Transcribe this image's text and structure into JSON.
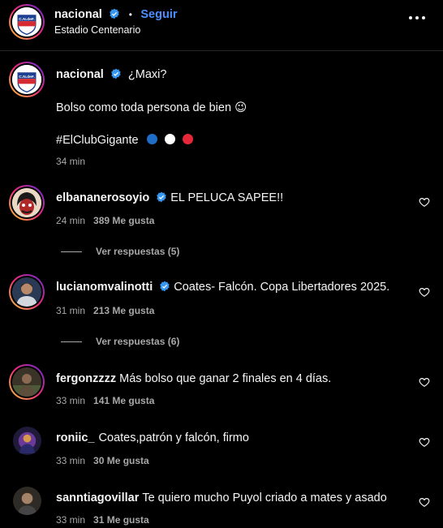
{
  "header": {
    "username": "nacional",
    "follow_label": "Seguir",
    "location": "Estadio Centenario",
    "crest_text": "C.N.deF."
  },
  "caption": {
    "username": "nacional",
    "text_line1": "¿Maxi?",
    "text_line2": "Bolso como toda persona de bien",
    "text_line2_emoji": "😉",
    "hashtag": "#ElClubGigante",
    "hashtag_colors": [
      "#1e6ec8",
      "#ffffff",
      "#e5283a"
    ],
    "time": "34 min"
  },
  "comments": [
    {
      "username": "elbananerosoyio",
      "verified": true,
      "text": "EL PELUCA SAPEE!!",
      "time": "24 min",
      "likes": "389 Me gusta",
      "replies": "Ver respuestas (5)"
    },
    {
      "username": "lucianomvalinotti",
      "verified": true,
      "text": "Coates- Falcón. Copa Libertadores 2025.",
      "time": "31 min",
      "likes": "213 Me gusta",
      "replies": "Ver respuestas (6)"
    },
    {
      "username": "fergonzzzz",
      "verified": false,
      "text": "Más bolso que ganar 2 finales en 4 días.",
      "time": "33 min",
      "likes": "141 Me gusta"
    },
    {
      "username": "roniic_",
      "verified": false,
      "text": "Coates,patrón y falcón, firmo",
      "time": "33 min",
      "likes": "30 Me gusta"
    },
    {
      "username": "sanntiagovillar",
      "verified": false,
      "text": "Te quiero mucho Puyol criado a mates y asado",
      "time": "33 min",
      "likes": "31 Me gusta"
    }
  ],
  "colors": {
    "background": "#000000",
    "text": "#f5f5f5",
    "secondary": "#a8a8a8",
    "link": "#4c8fff",
    "verified": "#3797f0"
  },
  "icons": {
    "more": "more-horizontal-icon",
    "verified": "verified-badge-icon",
    "like": "heart-outline-icon"
  }
}
